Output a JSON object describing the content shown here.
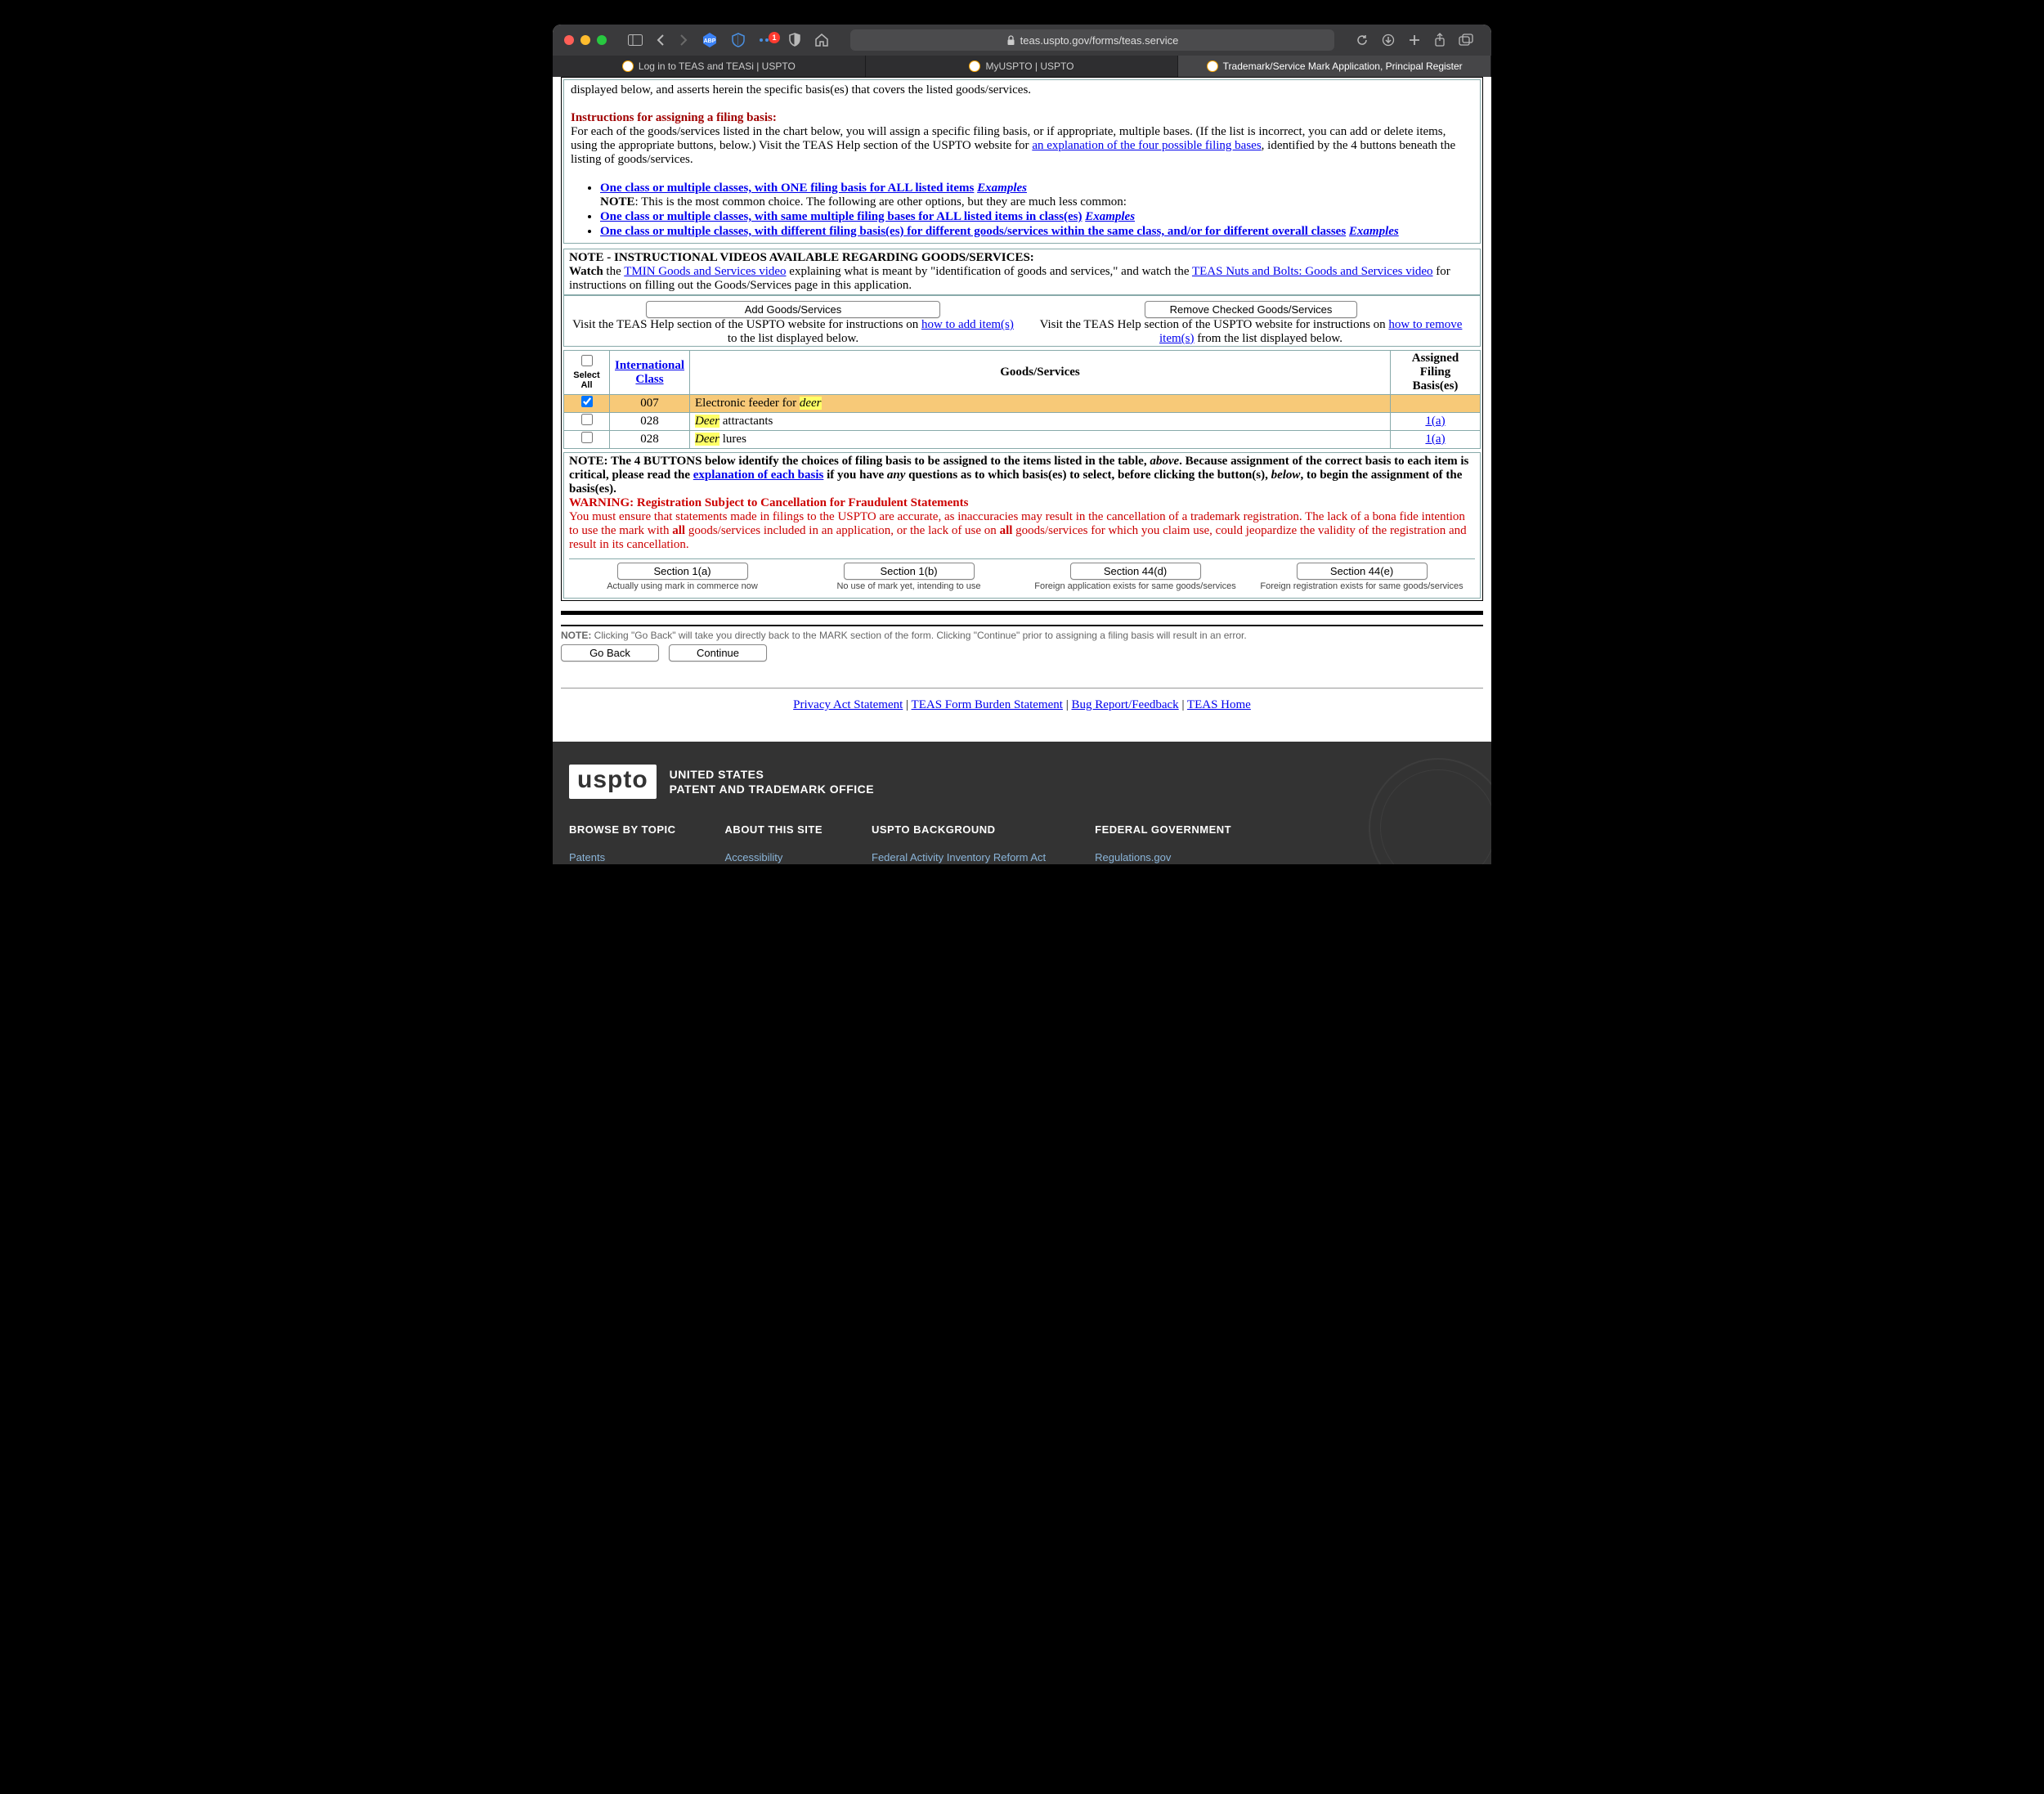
{
  "window": {
    "url": "teas.uspto.gov/forms/teas.service",
    "notif_badge": "1",
    "tabs": [
      "Log in to TEAS and TEASi | USPTO",
      "MyUSPTO | USPTO",
      "Trademark/Service Mark Application, Principal Register"
    ]
  },
  "intro_tail": "displayed below, and asserts herein the specific basis(es) that covers the listed goods/services.",
  "instructions": {
    "heading": "Instructions for assigning a filing basis:",
    "para_a": "For each of the goods/services listed in the chart below, you will assign a specific filing basis, or if appropriate, multiple bases. (If the list is incorrect, you can add or delete items, using the appropriate buttons, below.) Visit the TEAS Help section of the USPTO website for ",
    "link1": "an explanation of the four possible filing bases",
    "para_b": ", identified by the 4 buttons beneath the listing of goods/services.",
    "bullets": [
      {
        "text": "One class or multiple classes, with ONE filing basis for ALL listed items",
        "examples": "Examples"
      },
      {
        "text": "One class or multiple classes, with same multiple filing bases for ALL listed items in class(es)",
        "examples": "Examples"
      },
      {
        "text": "One class or multiple classes, with different filing basis(es) for different goods/services within the same class, and/or for different overall classes",
        "examples": "Examples"
      }
    ],
    "bullet_note_prefix": "NOTE",
    "bullet_note_text": ": This is the most common choice. The following are other options, but they are much less common:"
  },
  "videos": {
    "heading": "NOTE - INSTRUCTIONAL VIDEOS AVAILABLE REGARDING GOODS/SERVICES:",
    "watch": "Watch",
    "the": " the ",
    "link1": "TMIN Goods and Services video",
    "mid": " explaining what is meant by \"identification of goods and services,\" and watch the ",
    "link2": "TEAS Nuts and Bolts: Goods and Services video",
    "tail": " for instructions on filling out the Goods/Services page in this application."
  },
  "add_remove": {
    "add_btn": "Add Goods/Services",
    "add_text_a": "Visit the TEAS Help section of the USPTO website for instructions on ",
    "add_link": "how to add item(s)",
    "add_text_b": " to the list displayed below.",
    "remove_btn": "Remove Checked Goods/Services",
    "remove_text_a": "Visit the TEAS Help section of the USPTO website for instructions on ",
    "remove_link": "how to remove item(s)",
    "remove_text_b": " from the list displayed below."
  },
  "table": {
    "select_all": "Select All",
    "col_class_link": "International Class",
    "col_goods": "Goods/Services",
    "col_basis": "Assigned Filing Basis(es)",
    "rows": [
      {
        "checked": true,
        "cls": "007",
        "desc_pre": "Electronic feeder for ",
        "hl": "deer",
        "desc_post": "",
        "basis": ""
      },
      {
        "checked": false,
        "cls": "028",
        "desc_pre": "",
        "hl": "Deer",
        "desc_post": " attractants",
        "basis": "1(a)"
      },
      {
        "checked": false,
        "cls": "028",
        "desc_pre": "",
        "hl": "Deer",
        "desc_post": " lures",
        "basis": "1(a)"
      }
    ]
  },
  "basis_note": {
    "a": "NOTE: The 4 BUTTONS below identify the choices of filing basis to be assigned to the items listed in the table, ",
    "above": "above",
    "b": ". Because assignment of the correct basis to each item is critical, please read the ",
    "link": "explanation of each basis",
    "c": " if you have ",
    "any": "any",
    "d": " questions as to which basis(es) to select, before clicking the button(s), ",
    "below": "below",
    "e": ", to begin the assignment of the basis(es).",
    "warn_head": "WARNING: Registration Subject to Cancellation for Fraudulent Statements",
    "warn_a": "You must ensure that statements made in filings to the USPTO are accurate, as inaccuracies may result in the cancellation of a trademark registration. The lack of a bona fide intention to use the mark with ",
    "warn_all1": "all",
    "warn_b": " goods/services included in an application, or the lack of use on ",
    "warn_all2": "all",
    "warn_c": " goods/services for which you claim use, could jeopardize the validity of the registration and result in its cancellation."
  },
  "basis_buttons": [
    {
      "label": "Section 1(a)",
      "sub": "Actually using mark in commerce now"
    },
    {
      "label": "Section 1(b)",
      "sub": "No use of mark yet, intending to use"
    },
    {
      "label": "Section 44(d)",
      "sub": "Foreign application exists for same goods/services"
    },
    {
      "label": "Section 44(e)",
      "sub": "Foreign registration exists for same goods/services"
    }
  ],
  "nav_note": {
    "label": "NOTE:",
    "text": " Clicking \"Go Back\" will take you directly back to the MARK section of the form. Clicking \"Continue\" prior to assigning a filing basis will result in an error."
  },
  "nav": {
    "back": "Go Back",
    "continue": "Continue"
  },
  "footer_links": {
    "a": "Privacy Act Statement",
    "b": "TEAS Form Burden Statement",
    "c": "Bug Report/Feedback",
    "d": "TEAS Home",
    "sep": " | "
  },
  "uspto": {
    "logo": "uspto",
    "name1": "UNITED STATES",
    "name2": "PATENT AND TRADEMARK OFFICE",
    "cols": [
      {
        "title": "BROWSE BY TOPIC",
        "link": "Patents"
      },
      {
        "title": "ABOUT THIS SITE",
        "link": "Accessibility"
      },
      {
        "title": "USPTO BACKGROUND",
        "link": "Federal Activity Inventory Reform Act"
      },
      {
        "title": "FEDERAL GOVERNMENT",
        "link": "Regulations.gov"
      }
    ]
  }
}
